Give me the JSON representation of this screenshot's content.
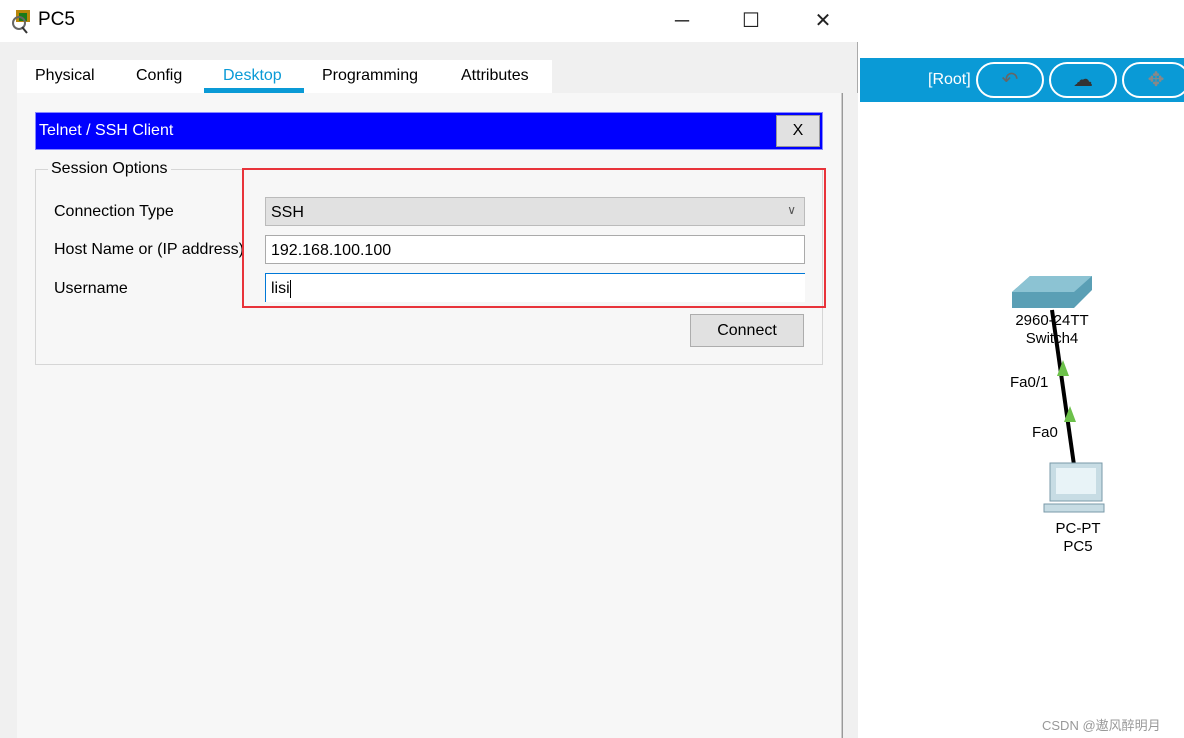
{
  "window": {
    "title": "PC5",
    "minimize": "─",
    "maximize": "☐",
    "close": "✕"
  },
  "tabs": [
    {
      "label": "Physical"
    },
    {
      "label": "Config"
    },
    {
      "label": "Desktop",
      "active": true
    },
    {
      "label": "Programming"
    },
    {
      "label": "Attributes"
    }
  ],
  "app": {
    "title": "Telnet / SSH Client",
    "close_label": "X",
    "header_color": "#0000ff"
  },
  "session": {
    "group_label": "Session Options",
    "connection_type_label": "Connection Type",
    "connection_type_value": "SSH",
    "host_label": "Host Name or (IP address)",
    "host_value": "192.168.100.100",
    "username_label": "Username",
    "username_value": "lisi",
    "connect_label": "Connect"
  },
  "topology": {
    "breadcrumb": "[Root]",
    "toolbar_icons": [
      "back-arrow-icon",
      "cloud-add-icon",
      "move-icon"
    ],
    "switch": {
      "model": "2960-24TT",
      "name": "Switch4",
      "port": "Fa0/1"
    },
    "pc": {
      "model": "PC-PT",
      "name": "PC5",
      "port": "Fa0"
    },
    "link_status_color": "#6cc04a"
  },
  "watermark": "CSDN @遨风醉明月"
}
